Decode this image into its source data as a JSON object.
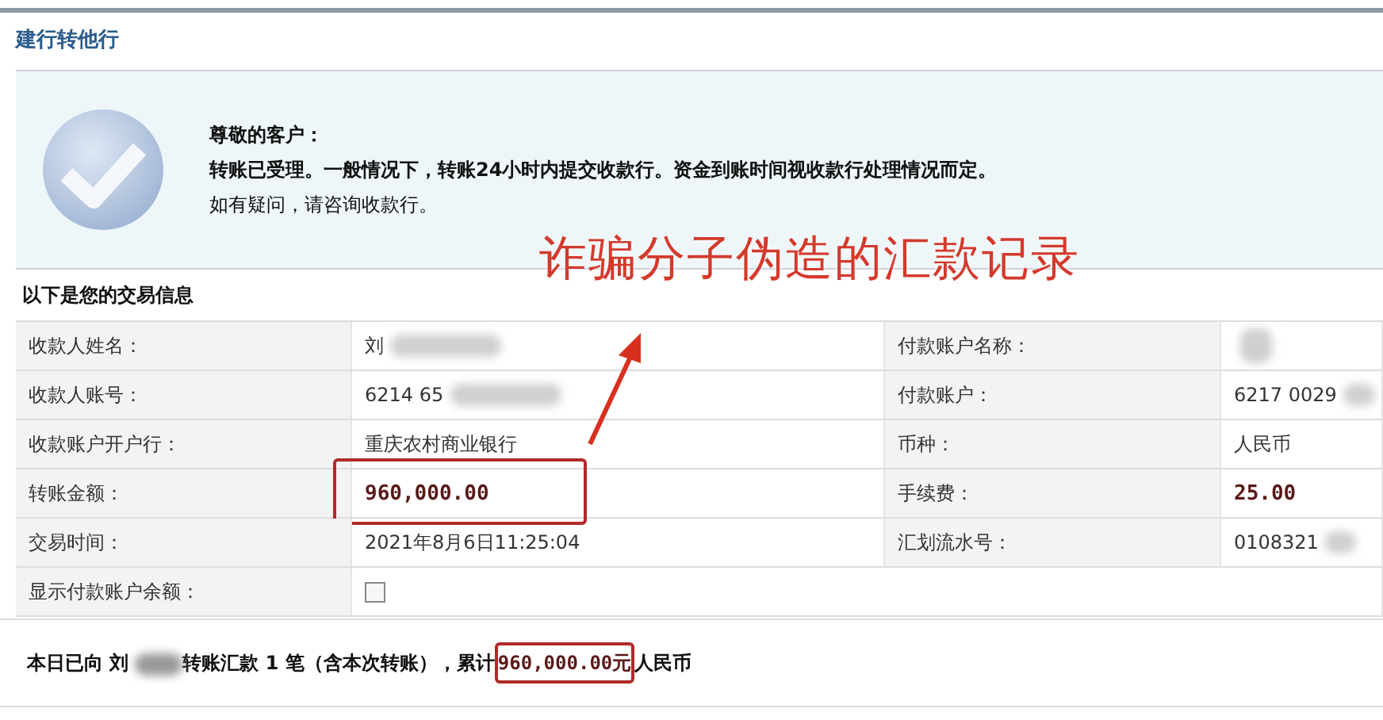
{
  "page_title": "建行转他行",
  "notice": {
    "greeting": "尊敬的客户：",
    "message": "转账已受理。一般情况下，转账24小时内提交收款行。资金到账时间视收款行处理情况而定。",
    "hint": "如有疑问，请咨询收款行。"
  },
  "annotation": {
    "text": "诈骗分子伪造的汇款记录"
  },
  "section_title": "以下是您的交易信息",
  "rows": [
    {
      "cells": [
        {
          "kind": "label",
          "text": "收款人姓名："
        },
        {
          "kind": "text",
          "text": "刘",
          "blurred": true
        },
        {
          "kind": "label",
          "text": "付款账户名称："
        },
        {
          "kind": "blurred"
        }
      ]
    },
    {
      "cells": [
        {
          "kind": "label",
          "text": "收款人账号："
        },
        {
          "kind": "text",
          "text": "6214 65",
          "blurred": true
        },
        {
          "kind": "label",
          "text": "付款账户："
        },
        {
          "kind": "text",
          "text": "6217 0029",
          "blurred": true
        }
      ]
    },
    {
      "cells": [
        {
          "kind": "label",
          "text": "收款账户开户行："
        },
        {
          "kind": "text",
          "text": "重庆农村商业银行"
        },
        {
          "kind": "label",
          "text": "币种："
        },
        {
          "kind": "text",
          "text": "人民币"
        }
      ]
    },
    {
      "cells": [
        {
          "kind": "label",
          "text": "转账金额："
        },
        {
          "kind": "amount",
          "text": "960,000.00",
          "boxed": true
        },
        {
          "kind": "label",
          "text": "手续费："
        },
        {
          "kind": "amount",
          "text": "25.00"
        }
      ]
    },
    {
      "cells": [
        {
          "kind": "label",
          "text": "交易时间："
        },
        {
          "kind": "text",
          "text": "2021年8月6日11:25:04"
        },
        {
          "kind": "label",
          "text": "汇划流水号："
        },
        {
          "kind": "text",
          "text": "0108321",
          "blurred": true
        }
      ]
    },
    {
      "cells": [
        {
          "kind": "label",
          "text": "显示付款账户余额："
        },
        {
          "kind": "checkbox",
          "checked": false
        }
      ]
    }
  ],
  "summary": {
    "before": "本日已向 刘",
    "middle": "转账汇款 1 笔（含本次转账），累计",
    "amount": "960,000.00元",
    "after": "人民币"
  }
}
